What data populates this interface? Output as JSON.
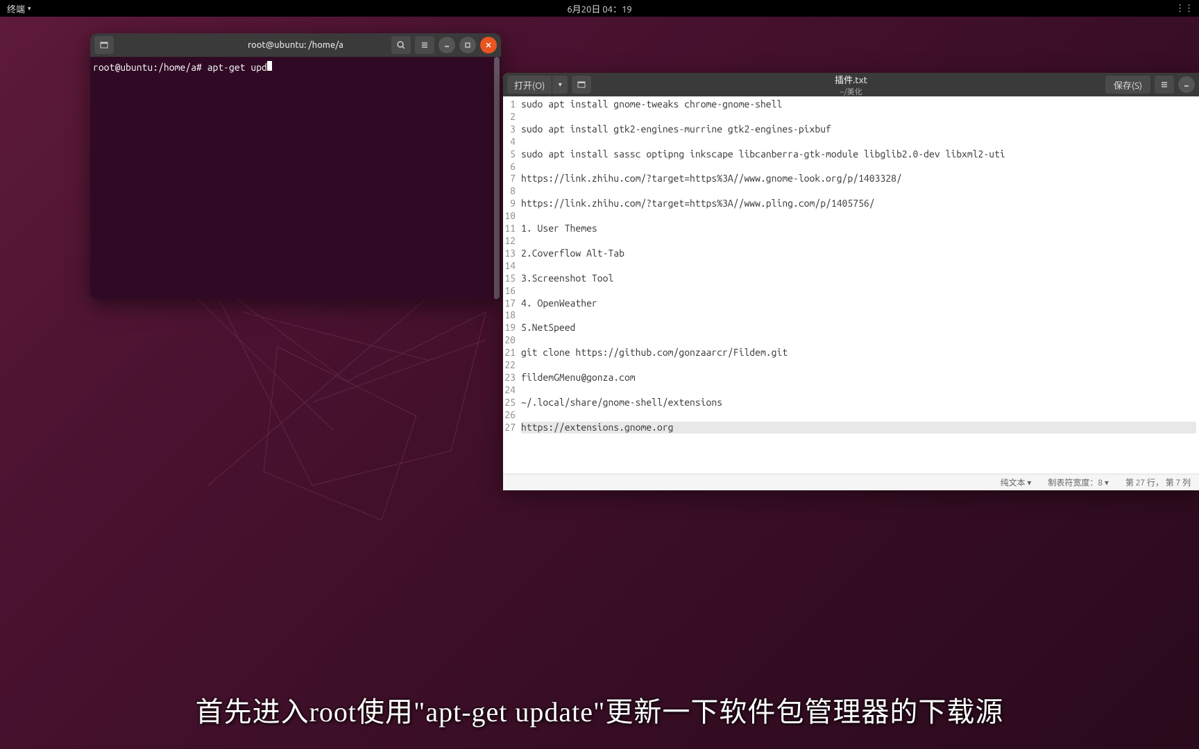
{
  "topbar": {
    "app_label": "终端",
    "datetime": "6月20日  04：19"
  },
  "terminal": {
    "title": "root@ubuntu: /home/a",
    "prompt": "root@ubuntu:/home/a# ",
    "command": "apt-get upd"
  },
  "editor": {
    "open_label": "打开(O)",
    "save_label": "保存(S)",
    "filename": "插件.txt",
    "filepath": "~/美化",
    "current_line_index": 26,
    "lines": [
      "sudo apt install gnome-tweaks chrome-gnome-shell",
      "",
      "sudo apt install gtk2-engines-murrine gtk2-engines-pixbuf",
      "",
      "sudo apt install sassc optipng inkscape libcanberra-gtk-module libglib2.0-dev libxml2-uti",
      "",
      "https://link.zhihu.com/?target=https%3A//www.gnome-look.org/p/1403328/",
      "",
      "https://link.zhihu.com/?target=https%3A//www.pling.com/p/1405756/",
      "",
      "1. User Themes",
      "",
      "2.Coverflow Alt-Tab",
      "",
      "3.Screenshot Tool",
      "",
      "4. OpenWeather",
      "",
      "5.NetSpeed",
      "",
      "git clone https://github.com/gonzaarcr/Fildem.git",
      "",
      "fildemGMenu@gonza.com",
      "",
      "~/.local/share/gnome-shell/extensions",
      "",
      "https://extensions.gnome.org"
    ],
    "statusbar": {
      "mode": "纯文本 ▾",
      "tab_width": "制表符宽度：8 ▾",
      "position": "第 27 行， 第 7 列"
    }
  },
  "subtitle": {
    "text": "首先进入root使用\"apt-get update\"更新一下软件包管理器的下载源"
  }
}
